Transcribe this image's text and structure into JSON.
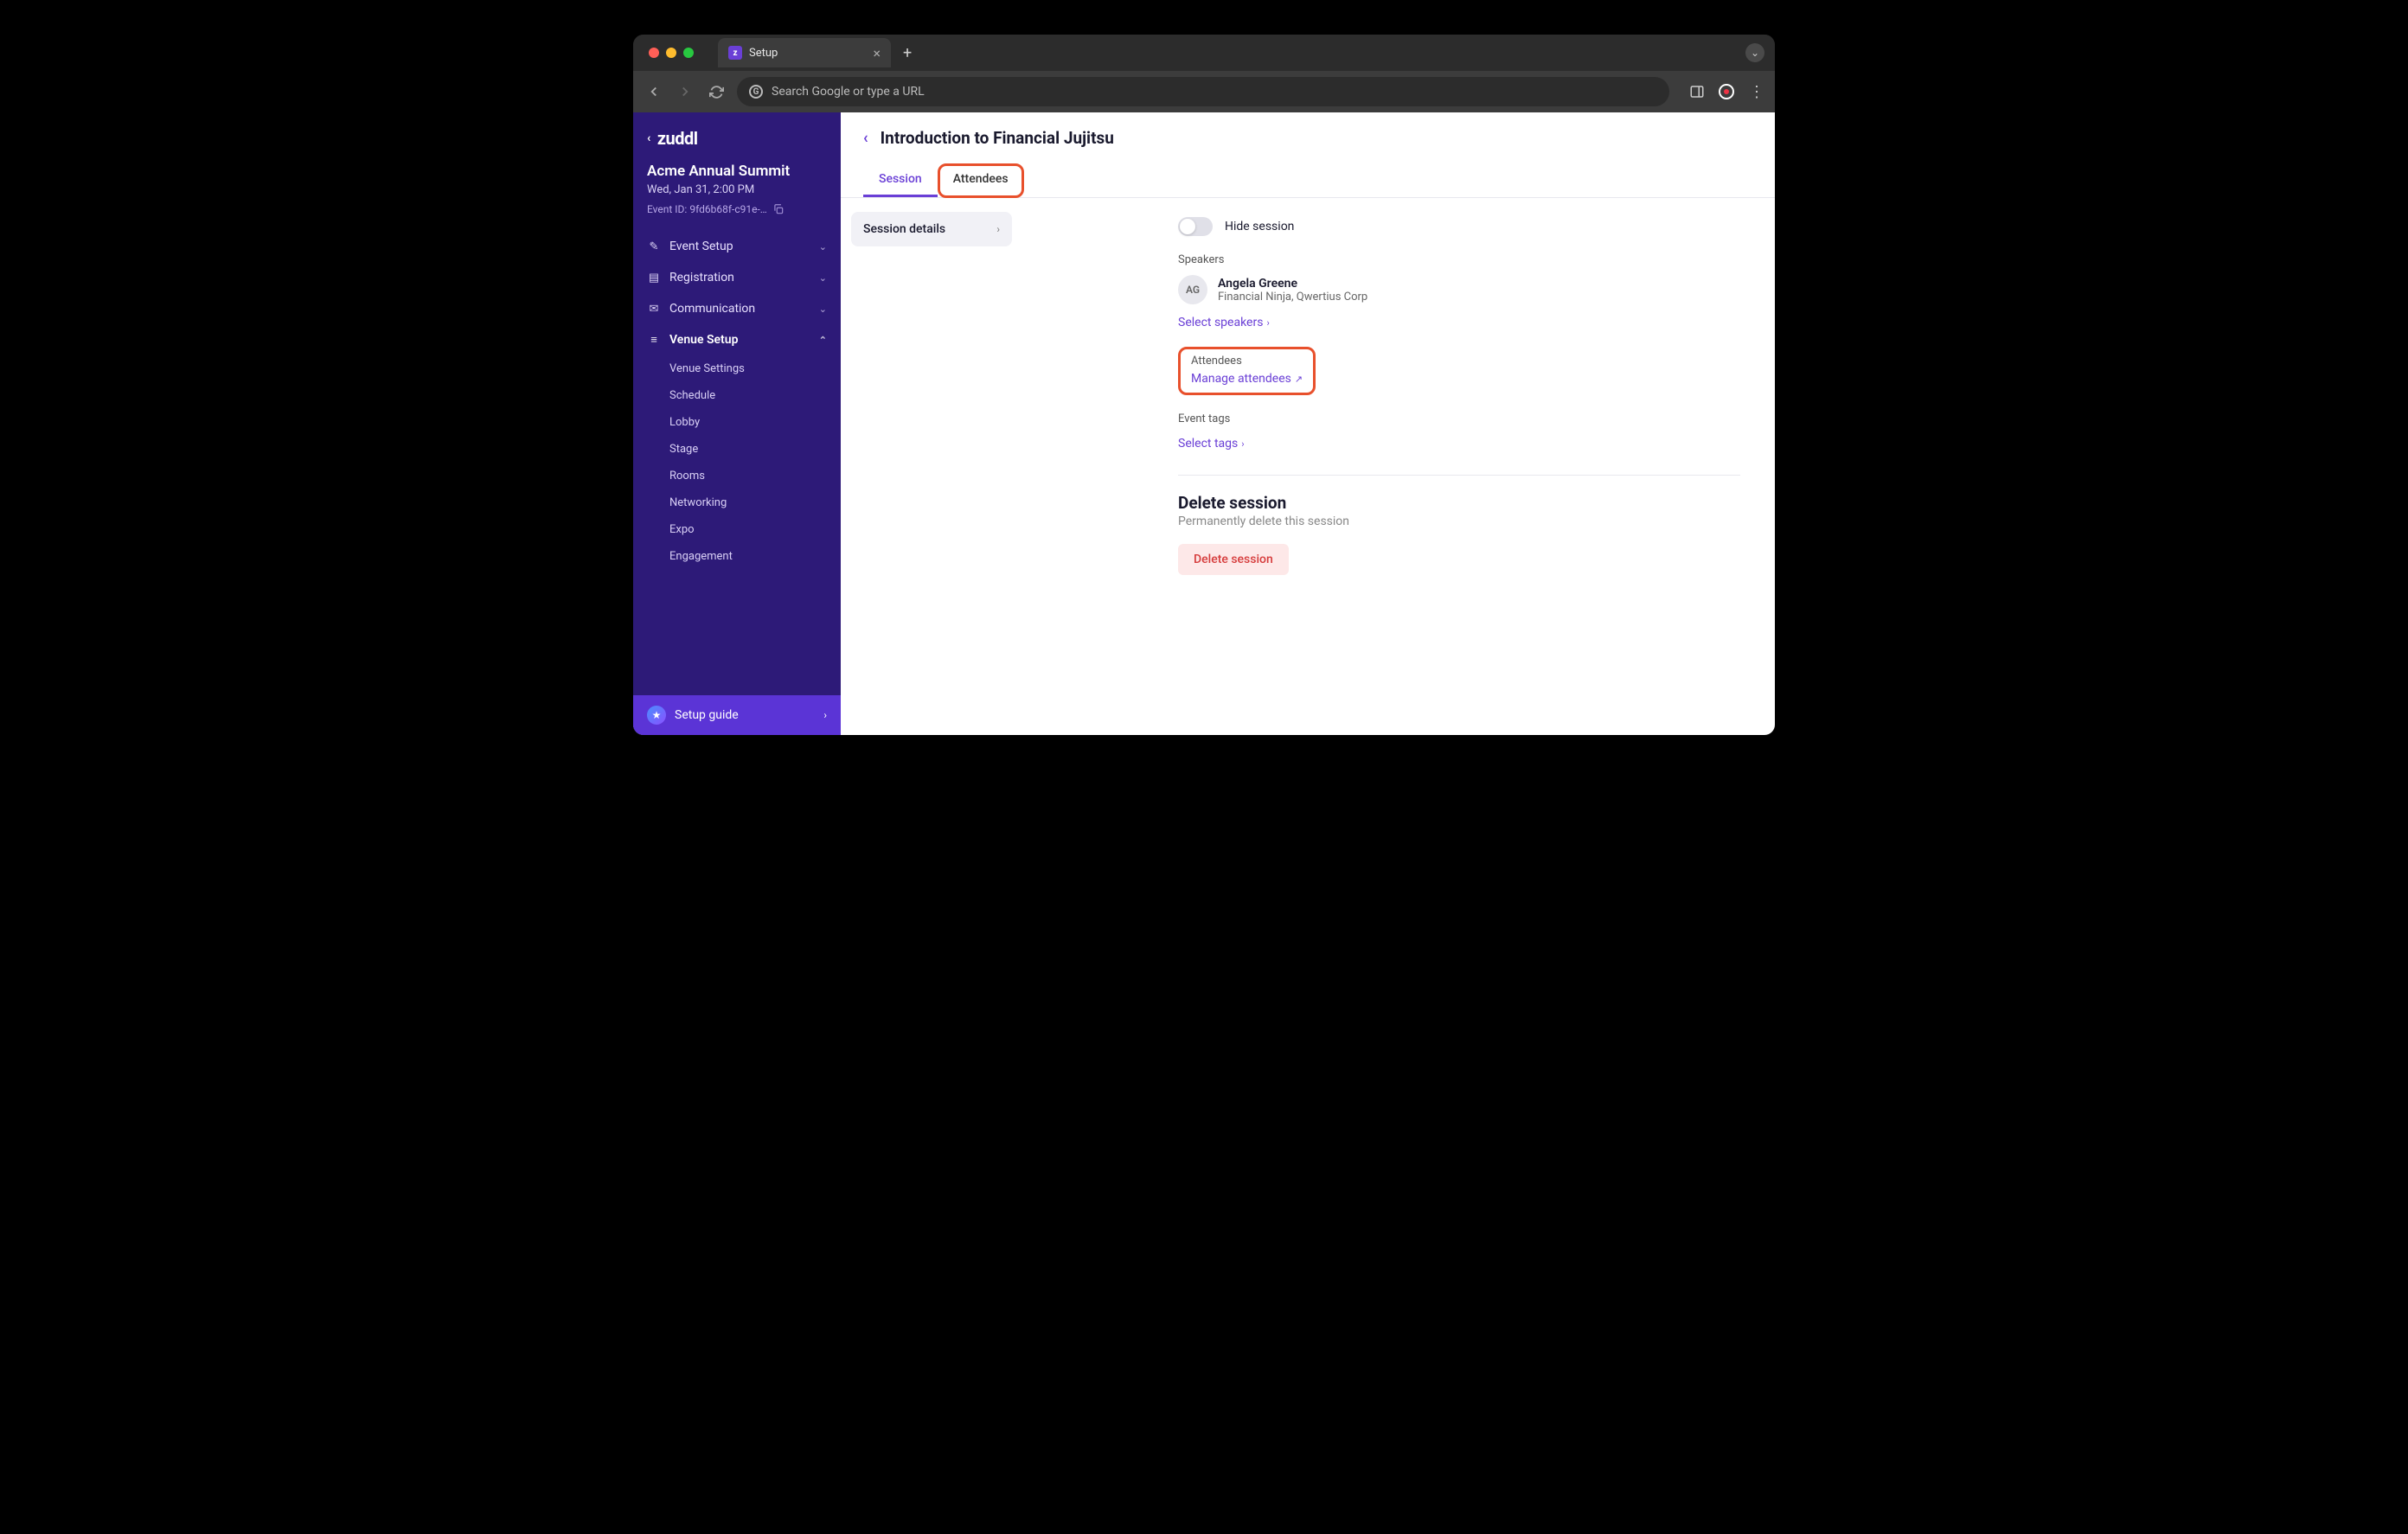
{
  "browser": {
    "tab_title": "Setup",
    "omnibox_placeholder": "Search Google or type a URL"
  },
  "sidebar": {
    "logo": "zuddl",
    "event_name": "Acme Annual Summit",
    "event_date": "Wed, Jan 31, 2:00 PM",
    "event_id_label": "Event ID: 9fd6b68f-c91e-…",
    "menu": [
      {
        "label": "Event Setup",
        "icon": "✎"
      },
      {
        "label": "Registration",
        "icon": "▤"
      },
      {
        "label": "Communication",
        "icon": "✉"
      },
      {
        "label": "Venue Setup",
        "icon": "≡",
        "expanded": true
      }
    ],
    "venue_sub": [
      "Venue Settings",
      "Schedule",
      "Lobby",
      "Stage",
      "Rooms",
      "Networking",
      "Expo",
      "Engagement"
    ],
    "setup_guide": "Setup guide"
  },
  "page": {
    "title": "Introduction to Financial Jujitsu",
    "tabs": [
      "Session",
      "Attendees"
    ],
    "subnav": "Session details",
    "hide_session": "Hide session",
    "speakers_label": "Speakers",
    "speaker": {
      "initials": "AG",
      "name": "Angela Greene",
      "role": "Financial Ninja, Qwertius Corp"
    },
    "select_speakers": "Select speakers",
    "attendees_label": "Attendees",
    "manage_attendees": "Manage attendees",
    "event_tags_label": "Event tags",
    "select_tags": "Select tags",
    "delete_title": "Delete session",
    "delete_sub": "Permanently delete this session",
    "delete_btn": "Delete session"
  }
}
